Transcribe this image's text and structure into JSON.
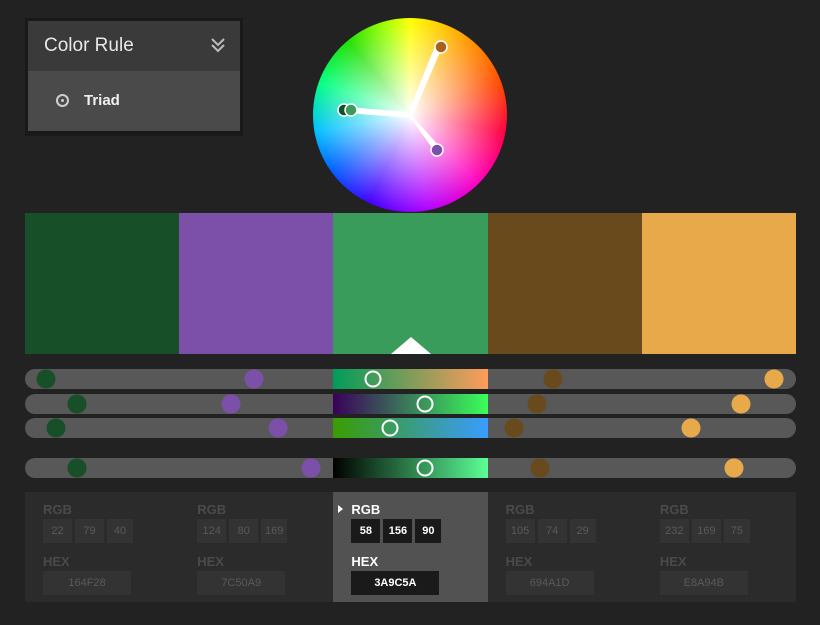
{
  "color_rule": {
    "title": "Color Rule",
    "selected_option": "Triad"
  },
  "wheel": {
    "markers": [
      {
        "color": "#A85F20"
      },
      {
        "color": "#164F28"
      },
      {
        "color": "#7C50A9"
      },
      {
        "color": "#3A9C5A"
      }
    ]
  },
  "swatches": [
    {
      "hex_color": "#164F28"
    },
    {
      "hex_color": "#7C50A9"
    },
    {
      "hex_color": "#3A9C5A"
    },
    {
      "hex_color": "#694A1D"
    },
    {
      "hex_color": "#E8A94B"
    }
  ],
  "active_index": 2,
  "values": [
    {
      "rgb_label": "RGB",
      "r": "22",
      "g": "79",
      "b": "40",
      "hex_label": "HEX",
      "hex": "164F28"
    },
    {
      "rgb_label": "RGB",
      "r": "124",
      "g": "80",
      "b": "169",
      "hex_label": "HEX",
      "hex": "7C50A9"
    },
    {
      "rgb_label": "RGB",
      "r": "58",
      "g": "156",
      "b": "90",
      "hex_label": "HEX",
      "hex": "3A9C5A"
    },
    {
      "rgb_label": "RGB",
      "r": "105",
      "g": "74",
      "b": "29",
      "hex_label": "HEX",
      "hex": "694A1D"
    },
    {
      "rgb_label": "RGB",
      "r": "232",
      "g": "169",
      "b": "75",
      "hex_label": "HEX",
      "hex": "E8A94B"
    }
  ]
}
